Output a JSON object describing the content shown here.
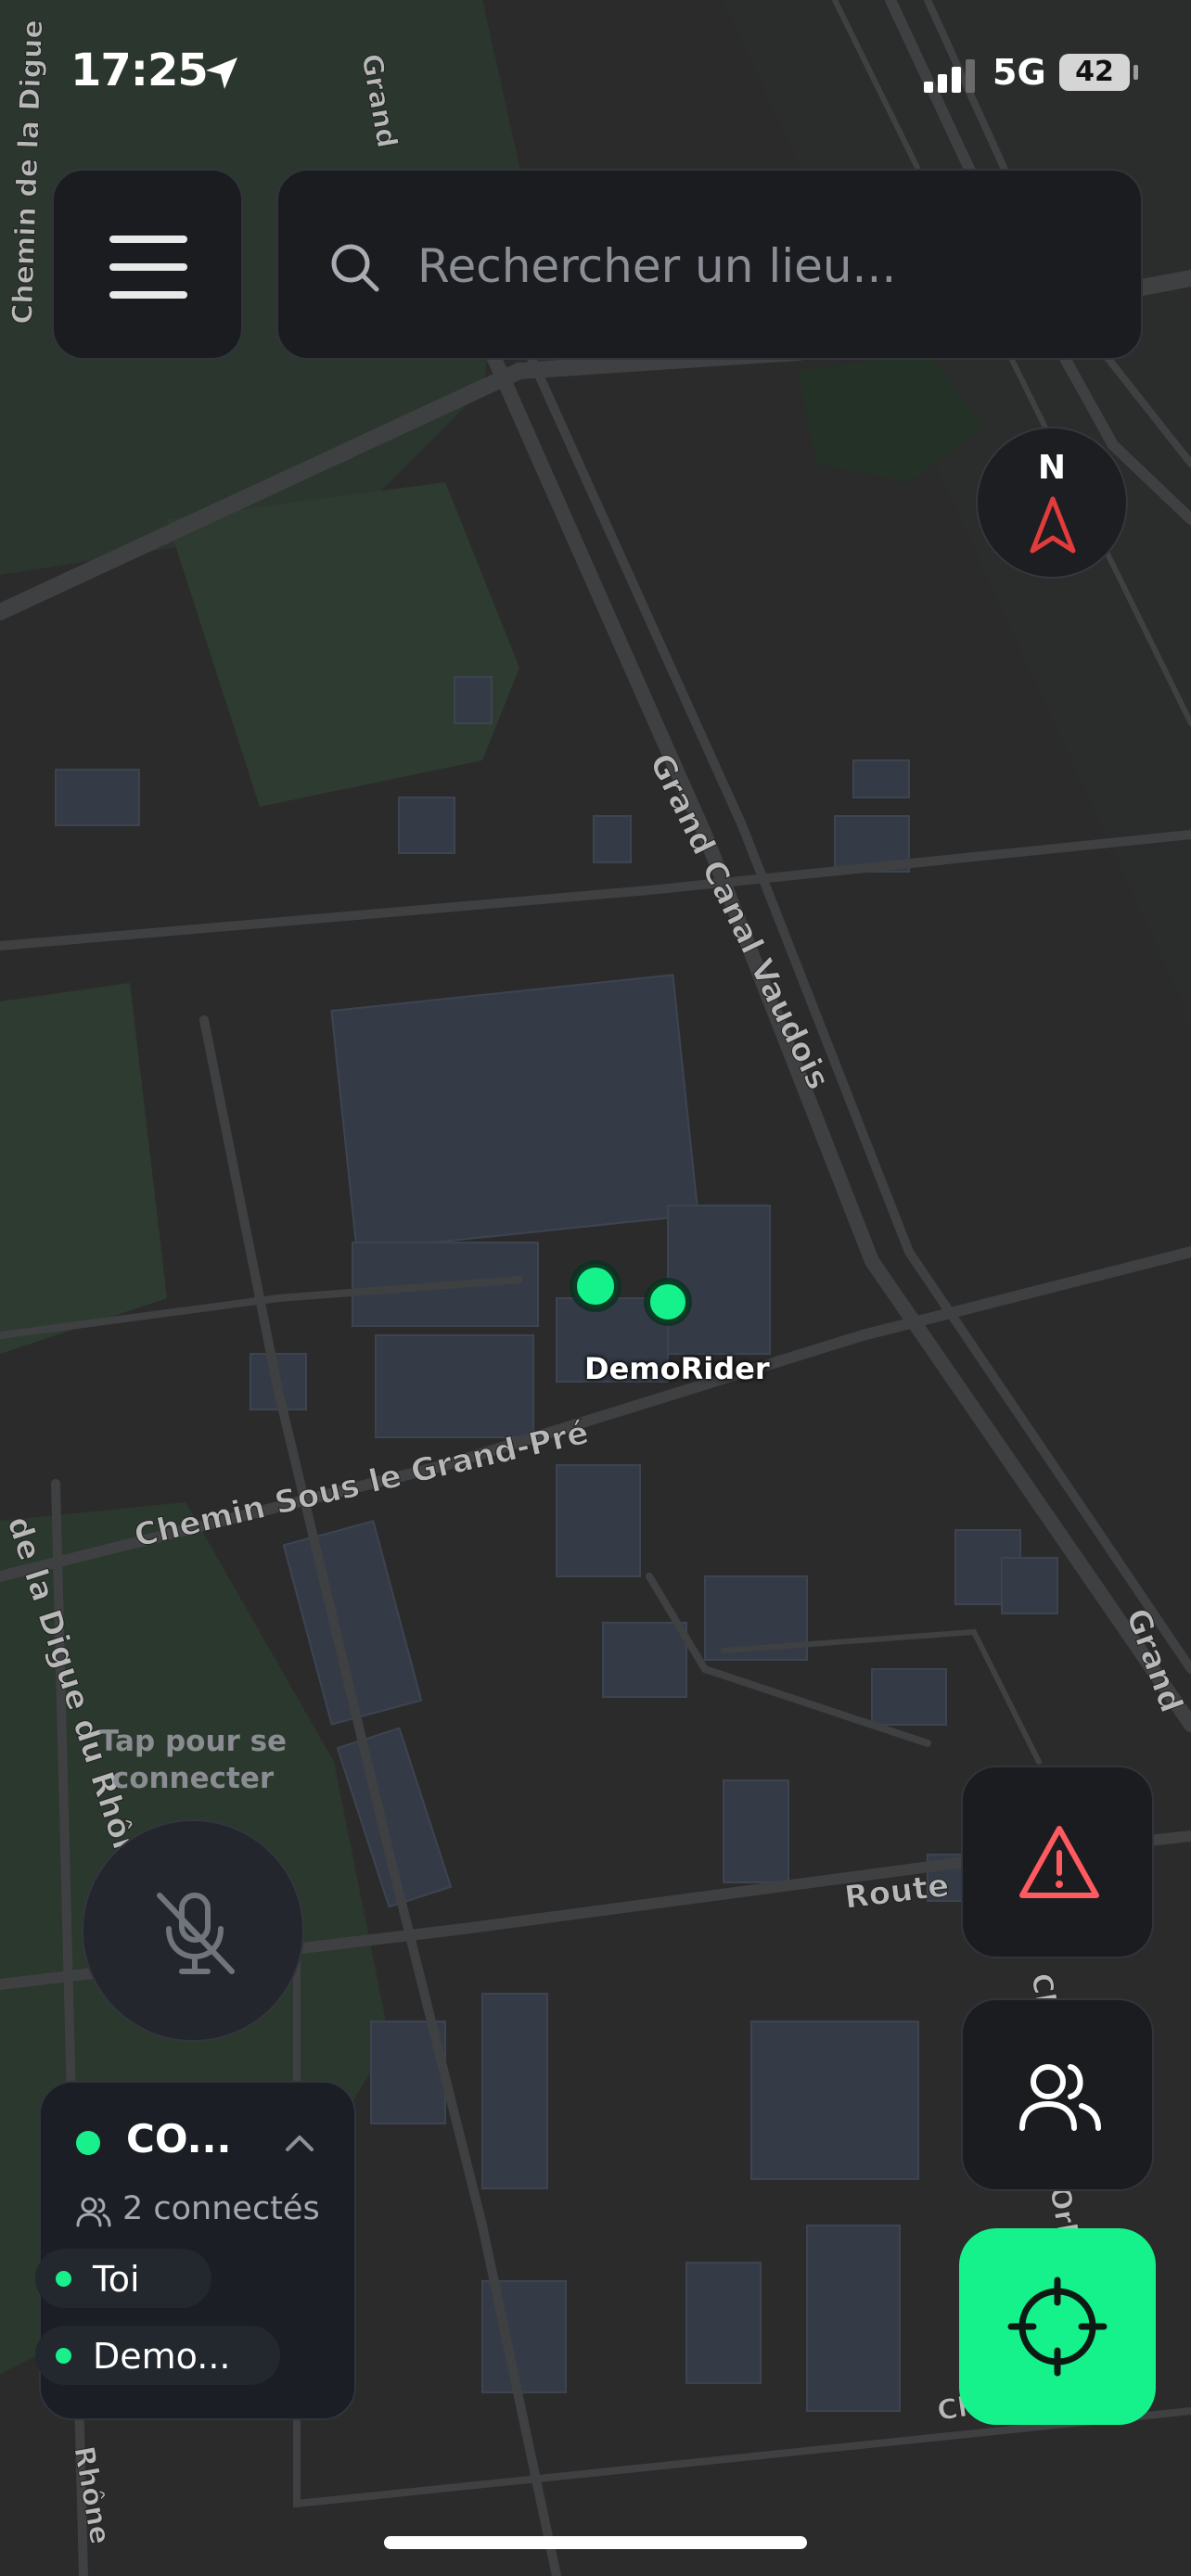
{
  "status_bar": {
    "time": "17:25",
    "network": "5G",
    "battery": "42"
  },
  "search": {
    "placeholder": "Rechercher un lieu..."
  },
  "compass": {
    "label": "N"
  },
  "map": {
    "street_labels": [
      "Grand Canal Vaudois",
      "Chemin Sous le Grand-Pré",
      "Route de Ev",
      "de la Digue du Rhône",
      "Chemin de la Digue",
      "Grand",
      "Grand",
      "Rhône",
      "Chemin",
      "Orlo",
      "Ch"
    ],
    "rider_label": "DemoRider"
  },
  "voice": {
    "hint": "Tap pour se connecter"
  },
  "room": {
    "name": "CO...",
    "connected_count": "2 connectés",
    "members": [
      "Toi",
      "Demo..."
    ]
  },
  "colors": {
    "accent_green": "#16f28b",
    "alert_red": "#ff5a5f",
    "panel_bg": "#1a1c20",
    "map_bg": "#2b2b2c"
  },
  "icons": {
    "menu": "hamburger-icon",
    "search": "search-icon",
    "compass": "compass-arrow-icon",
    "mic": "mic-off-icon",
    "alert": "warning-triangle-icon",
    "users": "users-icon",
    "locate": "crosshair-icon"
  }
}
